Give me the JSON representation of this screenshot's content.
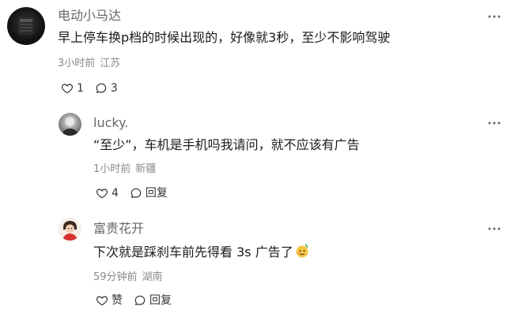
{
  "comments": [
    {
      "username": "电动小马达",
      "text": "早上停车换p档的时候出现的，好像就3秒，至少不影响驾驶",
      "time": "3小时前",
      "location": "江苏",
      "likes": "1",
      "replies": "3"
    },
    {
      "username": "lucky.",
      "text": "“至少”，车机是手机吗我请问，就不应该有广告",
      "time": "1小时前",
      "location": "新疆",
      "likes": "4",
      "reply_label": "回复"
    },
    {
      "username": "富贵花开",
      "text": "下次就是踩刹车前先得看 3s 广告了",
      "time": "59分钟前",
      "location": "湖南",
      "like_label": "赞",
      "reply_label": "回复"
    }
  ],
  "icons": {
    "more": "more-horizontal-icon",
    "like": "heart-outline-icon",
    "reply": "speech-bubble-icon",
    "emoji": "sweat-smile-emoji"
  }
}
